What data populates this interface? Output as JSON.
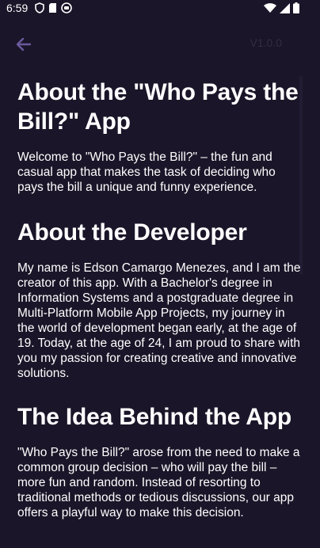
{
  "status_bar": {
    "time": "6:59"
  },
  "app_bar": {
    "version": "V1.0.0",
    "back_icon": "arrow-left-icon"
  },
  "sections": [
    {
      "title": "About the \"Who Pays the Bill?\" App",
      "body": "Welcome to \"Who Pays the Bill?\" – the fun and casual app that makes the task of deciding who pays the bill a unique and funny experience."
    },
    {
      "title": "About the Developer",
      "body": "My name is Edson Camargo Menezes, and I am the creator of this app. With a Bachelor's degree in Information Systems and a postgraduate degree in Multi-Platform Mobile App Projects, my journey in the world of development began early, at the age of 19. Today, at the age of 24, I am proud to share with you my passion for creating creative and innovative solutions."
    },
    {
      "title": "The Idea Behind the App",
      "body": "\"Who Pays the Bill?\" arose from the need to make a common group decision – who will pay the bill – more fun and random. Instead of resorting to traditional methods or tedious discussions, our app offers a playful way to make this decision."
    }
  ],
  "colors": {
    "background": "#1a1528",
    "accent": "#6a5a9e",
    "text": "#ffffff",
    "version_text": "#322c46"
  }
}
